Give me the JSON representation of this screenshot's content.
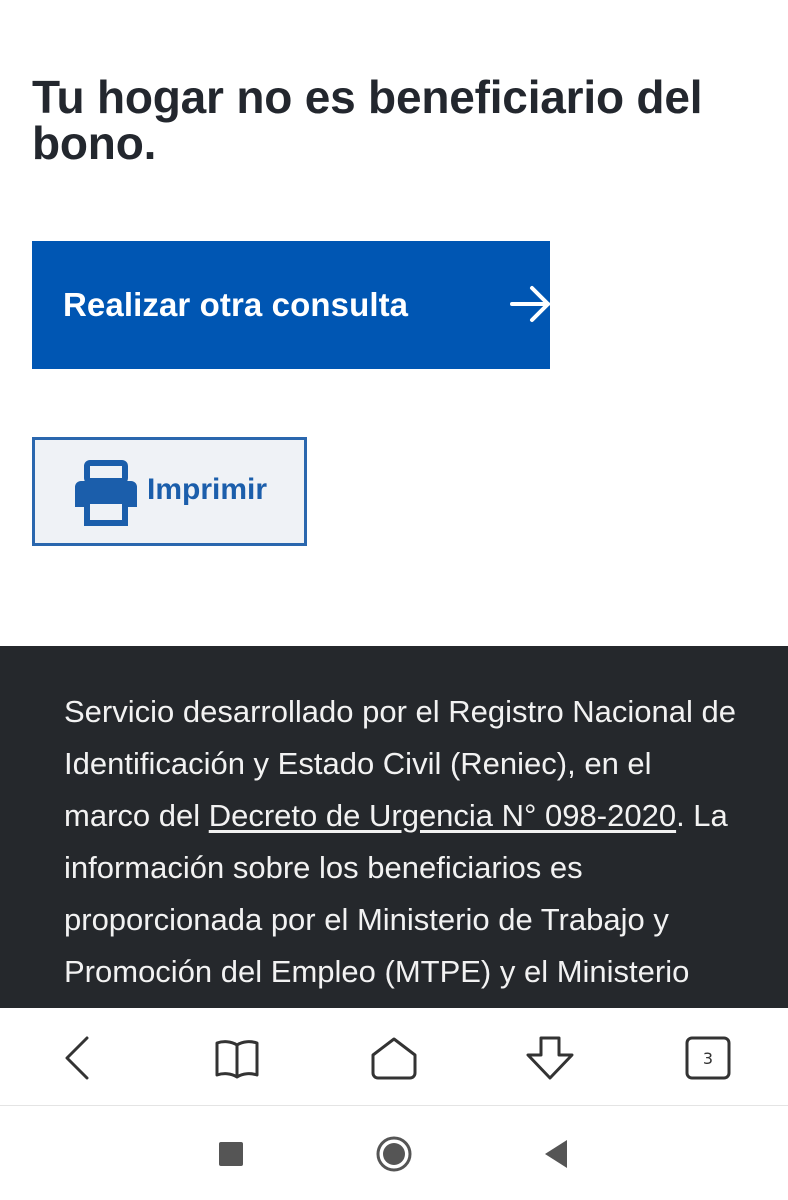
{
  "main": {
    "title": "Tu hogar no es beneficiario del bono.",
    "primary_button_label": "Realizar otra consulta",
    "print_button_label": "Imprimir"
  },
  "footer": {
    "text_before_link": "Servicio desarrollado por el Registro Nacional de Identificación y Estado Civil (Reniec), en el marco del ",
    "link_text": "Decreto de Urgencia N° 098-2020",
    "text_after_link": ". La información sobre los beneficiarios es proporcionada por el Ministerio de Trabajo y Promoción del Empleo (MTPE) y el Ministerio"
  },
  "browser_toolbar": {
    "tab_count": "3",
    "icons": [
      "back-icon",
      "bookmarks-icon",
      "home-icon",
      "download-icon",
      "tabs-icon"
    ]
  },
  "system_nav": {
    "icons": [
      "recents-icon",
      "home-circle-icon",
      "back-triangle-icon"
    ]
  },
  "colors": {
    "primary_button": "#0056b3",
    "print_button_border": "#2a67ae",
    "print_button_bg": "#eff2f6",
    "footer_bg": "#25282c",
    "title_text": "#23272e"
  }
}
